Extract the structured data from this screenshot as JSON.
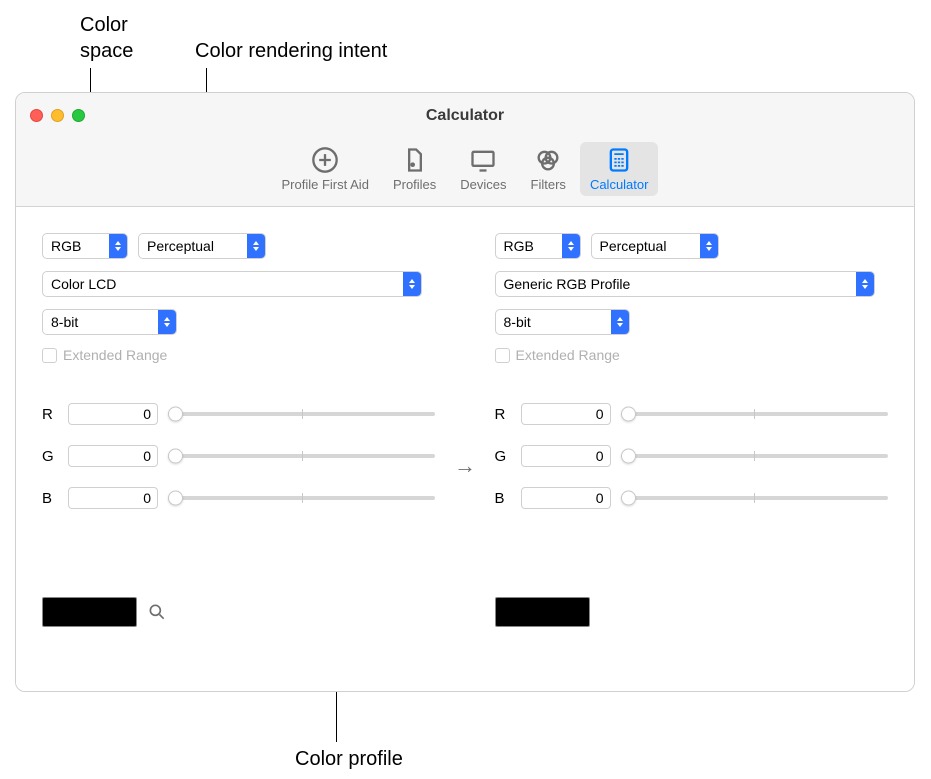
{
  "callouts": {
    "color_space": "Color space",
    "rendering_intent": "Color rendering intent",
    "color_profile": "Color profile"
  },
  "window": {
    "title": "Calculator"
  },
  "toolbar": {
    "items": [
      {
        "label": "Profile First Aid"
      },
      {
        "label": "Profiles"
      },
      {
        "label": "Devices"
      },
      {
        "label": "Filters"
      },
      {
        "label": "Calculator"
      }
    ],
    "selected": 4
  },
  "left": {
    "space": "RGB",
    "intent": "Perceptual",
    "profile": "Color LCD",
    "depth": "8-bit",
    "extended_label": "Extended Range",
    "channels": [
      {
        "label": "R",
        "value": "0"
      },
      {
        "label": "G",
        "value": "0"
      },
      {
        "label": "B",
        "value": "0"
      }
    ],
    "swatch_color": "#000000"
  },
  "right": {
    "space": "RGB",
    "intent": "Perceptual",
    "profile": "Generic RGB Profile",
    "depth": "8-bit",
    "extended_label": "Extended Range",
    "channels": [
      {
        "label": "R",
        "value": "0"
      },
      {
        "label": "G",
        "value": "0"
      },
      {
        "label": "B",
        "value": "0"
      }
    ],
    "swatch_color": "#000000"
  }
}
